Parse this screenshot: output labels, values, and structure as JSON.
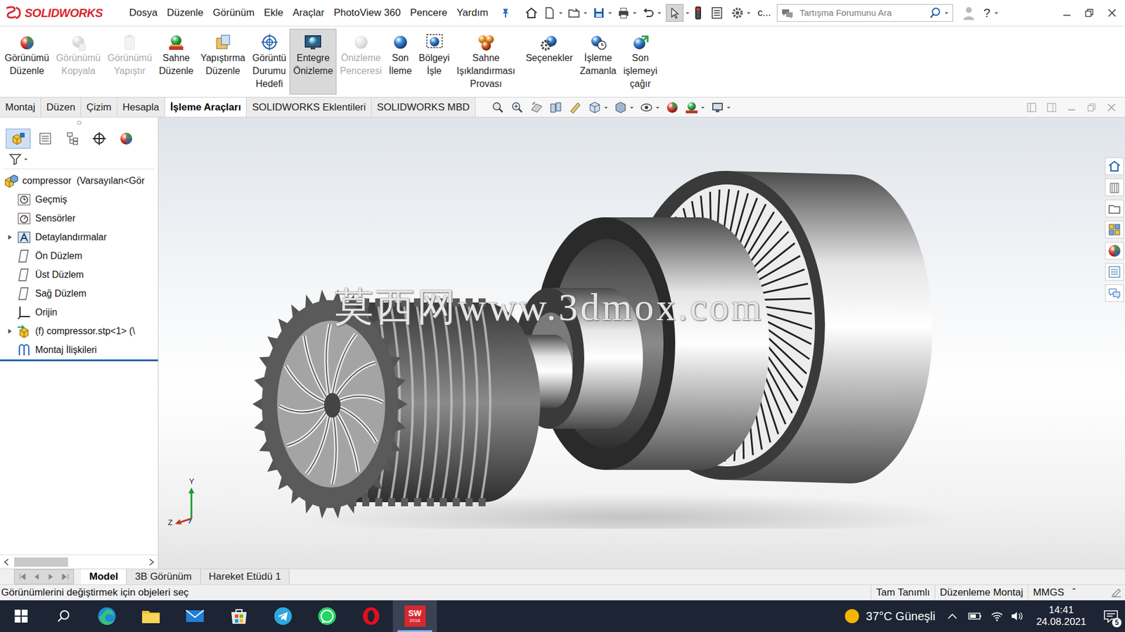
{
  "app": {
    "logo": "SOLIDWORKS"
  },
  "menu": [
    "Dosya",
    "Düzenle",
    "Görünüm",
    "Ekle",
    "Araçlar",
    "PhotoView 360",
    "Pencere",
    "Yardım"
  ],
  "quick_access": {
    "overflow": "c...",
    "help": "?"
  },
  "search": {
    "placeholder": "Tartışma Forumunu Ara"
  },
  "ribbon": [
    {
      "lines": [
        "Görünümü",
        "Düzenle"
      ],
      "disabled": false,
      "selected": false
    },
    {
      "lines": [
        "Görünümü",
        "Kopyala"
      ],
      "disabled": true,
      "selected": false
    },
    {
      "lines": [
        "Görünümü",
        "Yapıştır"
      ],
      "disabled": true,
      "selected": false
    },
    {
      "lines": [
        "Sahne",
        "Düzenle"
      ],
      "disabled": false,
      "selected": false
    },
    {
      "lines": [
        "Yapıştırma",
        "Düzenle"
      ],
      "disabled": false,
      "selected": false
    },
    {
      "lines": [
        "Görüntü",
        "Durumu",
        "Hedefi"
      ],
      "disabled": false,
      "selected": false
    },
    {
      "lines": [
        "Entegre",
        "Önizleme"
      ],
      "disabled": false,
      "selected": true
    },
    {
      "lines": [
        "Önizleme",
        "Penceresi"
      ],
      "disabled": true,
      "selected": false
    },
    {
      "lines": [
        "Son",
        "İleme"
      ],
      "disabled": false,
      "selected": false
    },
    {
      "lines": [
        "Bölgeyi",
        "İşle"
      ],
      "disabled": false,
      "selected": false
    },
    {
      "lines": [
        "Sahne",
        "Işıklandırması",
        "Provası"
      ],
      "disabled": false,
      "selected": false
    },
    {
      "lines": [
        "Seçenekler"
      ],
      "disabled": false,
      "selected": false
    },
    {
      "lines": [
        "İşleme",
        "Zamanla"
      ],
      "disabled": false,
      "selected": false
    },
    {
      "lines": [
        "Son",
        "işlemeyi",
        "çağır"
      ],
      "disabled": false,
      "selected": false
    }
  ],
  "tabs": [
    {
      "label": "Montaj",
      "selected": false
    },
    {
      "label": "Düzen",
      "selected": false
    },
    {
      "label": "Çizim",
      "selected": false
    },
    {
      "label": "Hesapla",
      "selected": false
    },
    {
      "label": "İşleme Araçları",
      "selected": true
    },
    {
      "label": "SOLIDWORKS Eklentileri",
      "selected": false
    },
    {
      "label": "SOLIDWORKS MBD",
      "selected": false
    }
  ],
  "panel_tabs": [
    {
      "selected": true
    },
    {
      "selected": false
    },
    {
      "selected": false
    },
    {
      "selected": false
    },
    {
      "selected": false
    }
  ],
  "feature_tree": {
    "root": "compressor  (Varsayılan<Gör",
    "items": [
      {
        "label": "Geçmiş",
        "expandable": false
      },
      {
        "label": "Sensörler",
        "expandable": false
      },
      {
        "label": "Detaylandırmalar",
        "expandable": true
      },
      {
        "label": "Ön Düzlem",
        "expandable": false
      },
      {
        "label": "Üst Düzlem",
        "expandable": false
      },
      {
        "label": "Sağ Düzlem",
        "expandable": false
      },
      {
        "label": "Orijin",
        "expandable": false
      },
      {
        "label": "(f) compressor.stp<1> (\\",
        "expandable": true
      },
      {
        "label": "Montaj İlişkileri",
        "expandable": false
      }
    ]
  },
  "viewport": {
    "watermark": "莫西网www.3dmox.com",
    "axes": [
      "Y",
      "Z"
    ]
  },
  "bottom_tabs": [
    {
      "label": "Model",
      "selected": true
    },
    {
      "label": "3B Görünüm",
      "selected": false
    },
    {
      "label": "Hareket Etüdü 1",
      "selected": false
    }
  ],
  "status_bar": {
    "message": "Görünümlerini değiştirmek için objeleri seç",
    "fields": [
      "Tam Tanımlı",
      "Düzenleme Montaj",
      "MMGS"
    ],
    "units_arrow": "ˆ"
  },
  "taskbar": {
    "apps": [
      {
        "selected": false
      },
      {
        "selected": false
      },
      {
        "selected": false
      },
      {
        "selected": false
      },
      {
        "selected": false
      },
      {
        "selected": false
      },
      {
        "selected": false
      },
      {
        "selected": true
      }
    ],
    "sw_label": "SW",
    "sw_version": "2018",
    "weather": "37°C Güneşli",
    "time": "14:41",
    "date": "24.08.2021",
    "notifications": "5"
  }
}
